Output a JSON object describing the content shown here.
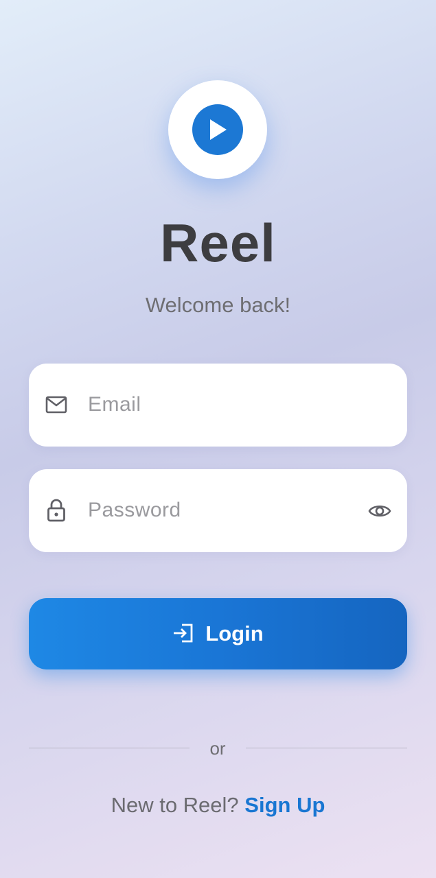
{
  "app": {
    "title": "Reel",
    "subtitle": "Welcome back!",
    "logo_icon": "play-icon",
    "accent_color": "#1c78d4"
  },
  "form": {
    "email": {
      "placeholder": "Email",
      "value": "",
      "icon": "mail-icon"
    },
    "password": {
      "placeholder": "Password",
      "value": "",
      "icon": "lock-icon",
      "toggle_icon": "eye-icon"
    },
    "login_button": {
      "label": "Login",
      "icon": "login-icon"
    }
  },
  "divider": {
    "text": "or"
  },
  "signup": {
    "prompt": "New to Reel?",
    "link": "Sign Up"
  }
}
